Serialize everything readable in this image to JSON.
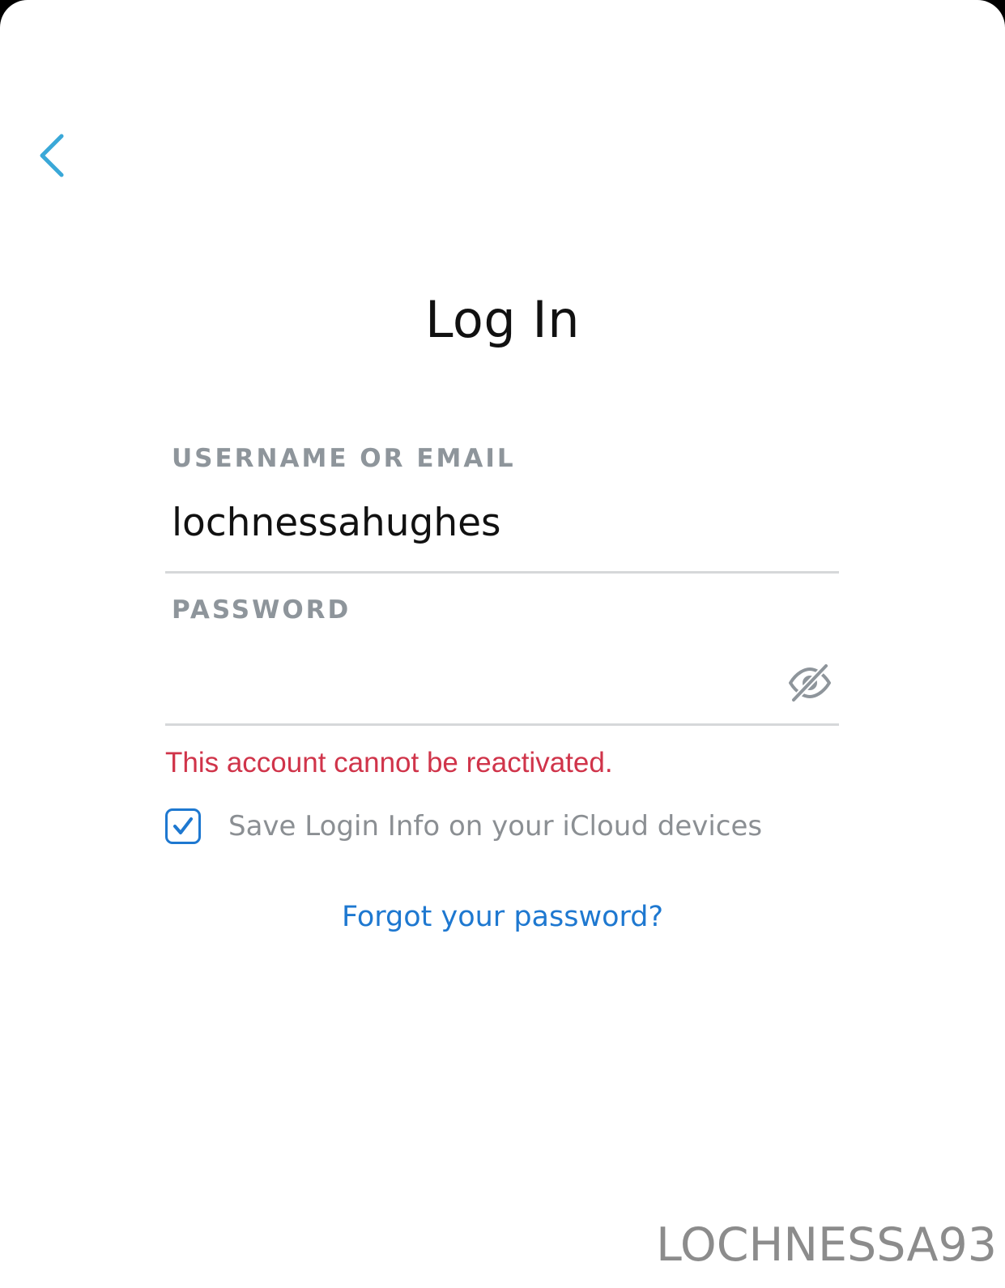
{
  "header": {
    "back_icon": "chevron-left-icon",
    "title": "Log In"
  },
  "form": {
    "username": {
      "label": "USERNAME OR EMAIL",
      "value": "lochnessahughes"
    },
    "password": {
      "label": "PASSWORD",
      "value": "",
      "toggle_icon": "eye-slash-icon"
    },
    "error_message": "This account cannot be reactivated.",
    "save_login": {
      "checked": true,
      "label": "Save Login Info on your iCloud devices"
    },
    "forgot_password_link": "Forgot your password?"
  },
  "watermark": "LOCHNESSA93",
  "colors": {
    "accent_blue": "#1e78d0",
    "back_arrow": "#3aa8d8",
    "error_red": "#d0344a",
    "label_gray": "#8e959b",
    "divider": "#d6d8da"
  }
}
